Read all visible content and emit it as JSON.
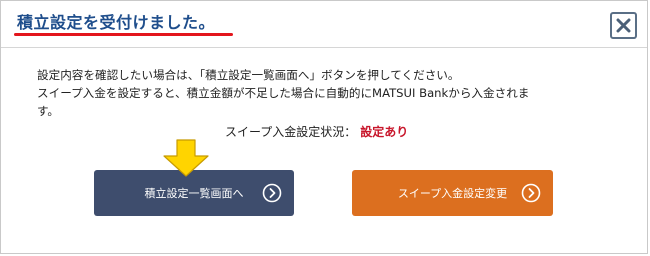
{
  "dialog": {
    "title": "積立設定を受付けました。",
    "close_icon": "close-x-icon"
  },
  "message": {
    "line1": "設定内容を確認したい場合は、「積立設定一覧画面へ」ボタンを押してください。",
    "line2": "スイープ入金を設定すると、積立金額が不足した場合に自動的にMATSUI Bankから入金されま",
    "line3": "す。"
  },
  "status": {
    "label": "スイープ入金設定状況：",
    "value": "設定あり"
  },
  "buttons": {
    "list_label": "積立設定一覧画面へ",
    "change_label": "スイープ入金設定変更"
  },
  "colors": {
    "title": "#1f4e8c",
    "underline": "#e3161d",
    "status_value": "#c8162b",
    "list_button": "#3e4d6d",
    "change_button": "#dc6f1f",
    "pointer_arrow": "#ffd400"
  }
}
